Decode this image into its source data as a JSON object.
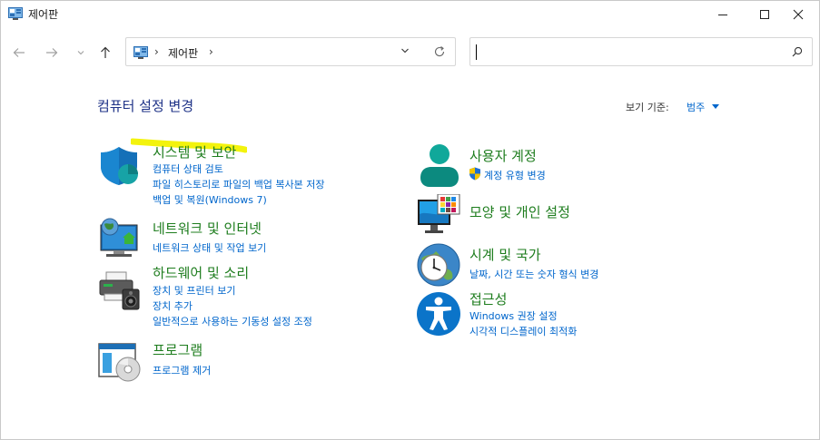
{
  "window": {
    "title": "제어판",
    "minimize_icon": "minimize-icon",
    "maximize_icon": "maximize-icon",
    "close_icon": "close-icon"
  },
  "nav": {
    "back_icon": "arrow-left-icon",
    "forward_icon": "arrow-right-icon",
    "recent_icon": "chevron-down-icon",
    "up_icon": "arrow-up-icon"
  },
  "address": {
    "breadcrumb": "제어판",
    "sep": "›"
  },
  "search": {
    "value": "",
    "placeholder": ""
  },
  "content": {
    "title": "컴퓨터 설정 변경",
    "view_by_label": "보기 기준:",
    "view_by_value": "범주"
  },
  "left_categories": [
    {
      "title": "시스템 및 보안",
      "links": [
        "컴퓨터 상태 검토",
        "파일 히스토리로 파일의 백업 복사본 저장",
        "백업 및 복원(Windows 7)"
      ]
    },
    {
      "title": "네트워크 및 인터넷",
      "links": [
        "네트워크 상태 및 작업 보기"
      ]
    },
    {
      "title": "하드웨어 및 소리",
      "links": [
        "장치 및 프린터 보기",
        "장치 추가",
        "일반적으로 사용하는 기동성 설정 조정"
      ]
    },
    {
      "title": "프로그램",
      "links": [
        "프로그램 제거"
      ]
    }
  ],
  "right_categories": [
    {
      "title": "사용자 계정",
      "links": [
        "계정 유형 변경"
      ]
    },
    {
      "title": "모양 및 개인 설정",
      "links": []
    },
    {
      "title": "시계 및 국가",
      "links": [
        "날짜, 시간 또는 숫자 형식 변경"
      ]
    },
    {
      "title": "접근성",
      "links": [
        "Windows 권장 설정",
        "시각적 디스플레이 최적화"
      ]
    }
  ],
  "colors": {
    "title_blue": "#1e3287",
    "category_green": "#1e7d1e",
    "link_blue": "#0066cc",
    "highlight_yellow": "#f5f500"
  }
}
